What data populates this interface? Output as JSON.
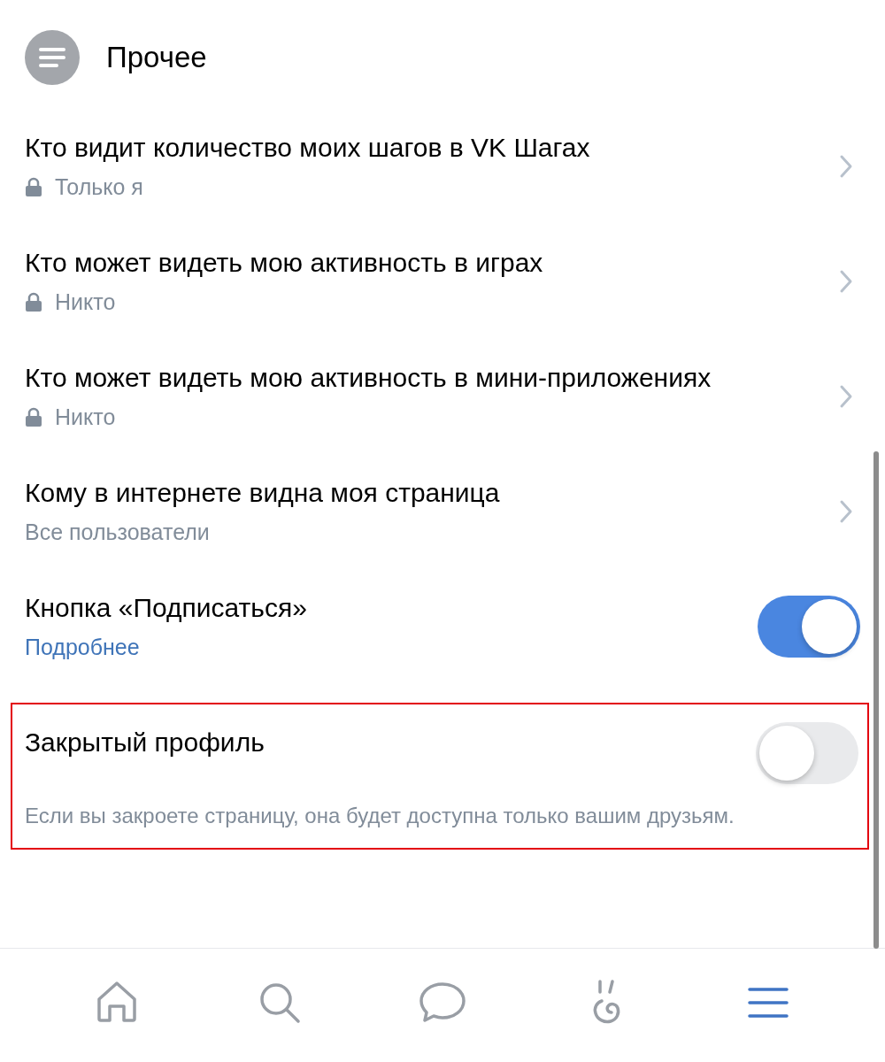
{
  "section": {
    "title": "Прочее"
  },
  "items": [
    {
      "kind": "link",
      "title": "Кто видит количество моих шагов в VK Шагах",
      "value": "Только я",
      "locked": true
    },
    {
      "kind": "link",
      "title": "Кто может видеть мою активность в играх",
      "value": "Никто",
      "locked": true
    },
    {
      "kind": "link",
      "title": "Кто может видеть мою активность в мини-приложениях",
      "value": "Никто",
      "locked": true
    },
    {
      "kind": "link",
      "title": "Кому в интернете видна моя страница",
      "value": "Все пользователи",
      "locked": false
    },
    {
      "kind": "toggle",
      "title": "Кнопка «Подписаться»",
      "link": "Подробнее",
      "on": true,
      "highlighted": false
    },
    {
      "kind": "toggle",
      "title": "Закрытый профиль",
      "description": "Если вы закроете страницу, она будет доступна только вашим друзьям.",
      "on": false,
      "highlighted": true
    }
  ],
  "tabbar": [
    {
      "kind": "home",
      "selected": false
    },
    {
      "kind": "search",
      "selected": false
    },
    {
      "kind": "chat",
      "selected": false
    },
    {
      "kind": "clips",
      "selected": false
    },
    {
      "kind": "menu",
      "selected": true
    }
  ]
}
